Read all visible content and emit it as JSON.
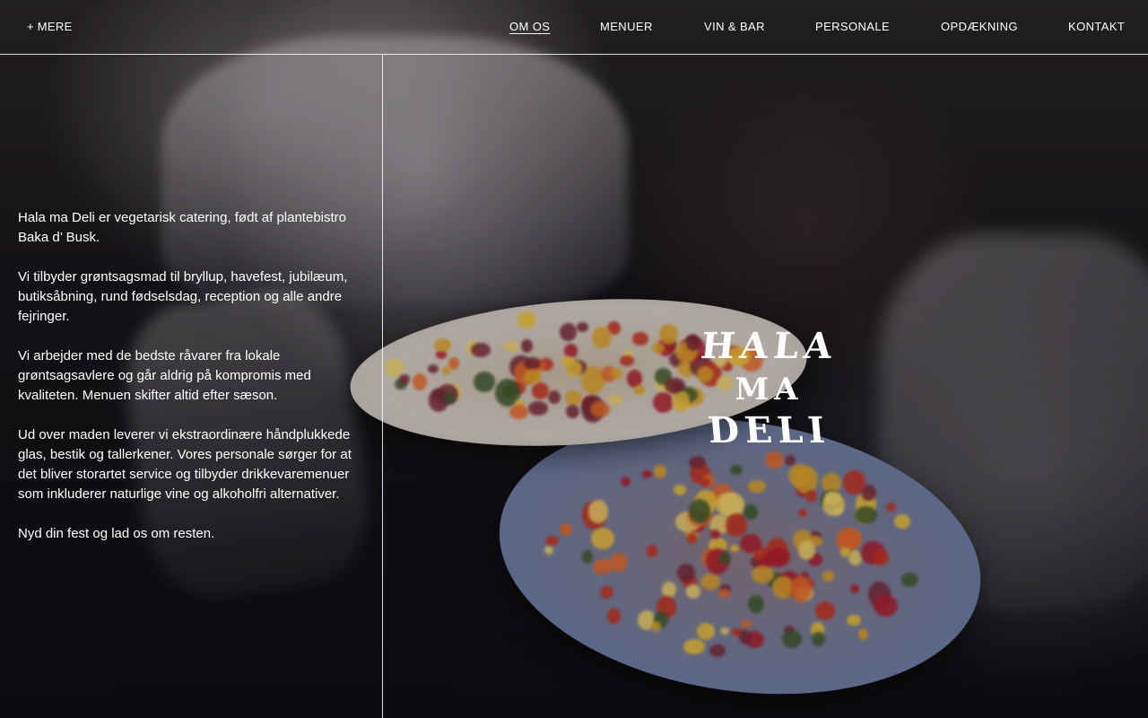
{
  "header": {
    "more_label": "+ MERE",
    "nav": [
      {
        "label": "OM OS",
        "active": true
      },
      {
        "label": "MENUER",
        "active": false
      },
      {
        "label": "VIN & BAR",
        "active": false
      },
      {
        "label": "PERSONALE",
        "active": false
      },
      {
        "label": "OPDÆKNING",
        "active": false
      },
      {
        "label": "KONTAKT",
        "active": false
      }
    ]
  },
  "about": {
    "paragraphs": [
      "Hala ma Deli er vegetarisk catering, født af plantebistro Baka d’ Busk.",
      "Vi tilbyder grøntsagsmad til bryllup, havefest, jubilæum, butiksåbning, rund fødselsdag, reception og alle andre fejringer.",
      "Vi arbejder med de bedste råvarer fra lokale grøntsagsavlere og går aldrig på kompromis med kvaliteten. Menuen skifter altid efter sæson.",
      "Ud over maden leverer vi ekstraordinære håndplukkede glas, bestik og tallerkener. Vores personale sørger for at det bliver storartet service og tilbyder drikkevaremenuer som inkluderer naturlige vine og alkoholfri alternativer.",
      "Nyd din fest og lad os om resten."
    ]
  },
  "logo": {
    "lines": [
      "HALA",
      "MA",
      "DELI"
    ]
  },
  "colors": {
    "text": "#ffffff",
    "background": "#0c0b10"
  }
}
